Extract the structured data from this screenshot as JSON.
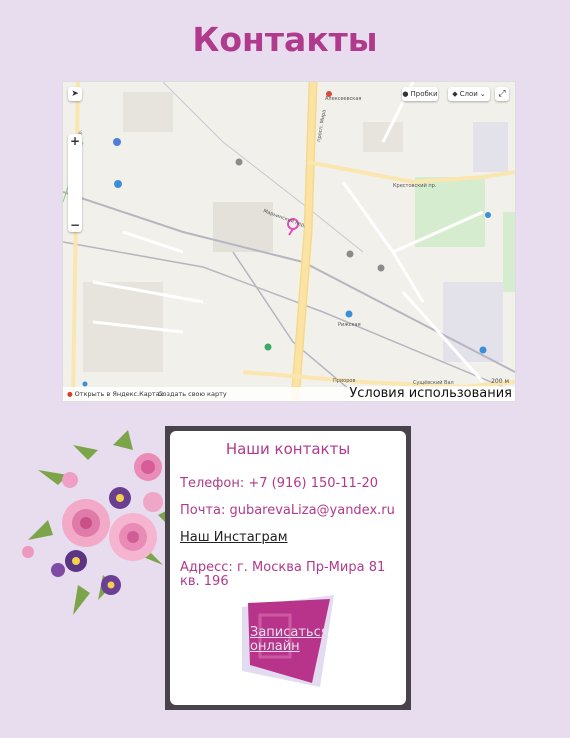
{
  "page": {
    "title": "Контакты"
  },
  "map": {
    "traffic_label": "Пробки",
    "layers_label": "Слои",
    "open_label": "Открыть в Яндекс.Картах",
    "create_label": "Создать свою карту",
    "terms_label": "Условия использования",
    "scale_label": "200 м",
    "zoom_in": "+",
    "zoom_out": "−",
    "streets": {
      "kaluzhsky": "Калужский пер.",
      "metro_vdnh": "Алексеевская",
      "mira": "просп. Мира",
      "rizhskaya": "Рижская",
      "krest": "Крестовский пр.",
      "marfinsky": "Марьинский пер.",
      "polo": "Приоров",
      "sushch": "Сущёвский Вал"
    }
  },
  "contacts": {
    "heading": "Наши контакты",
    "phone": "Телефон: +7 (916) 150-11-20",
    "email": "Почта: gubarevaLiza@yandex.ru",
    "instagram": "Наш Инстаграм",
    "address": "Адресс: г. Москва Пр-Мира 81 кв. 196",
    "cta_label": "Записаться онлайн"
  },
  "colors": {
    "background": "#e8dcef",
    "accent": "#b03a8b",
    "card_border": "#48434a"
  }
}
